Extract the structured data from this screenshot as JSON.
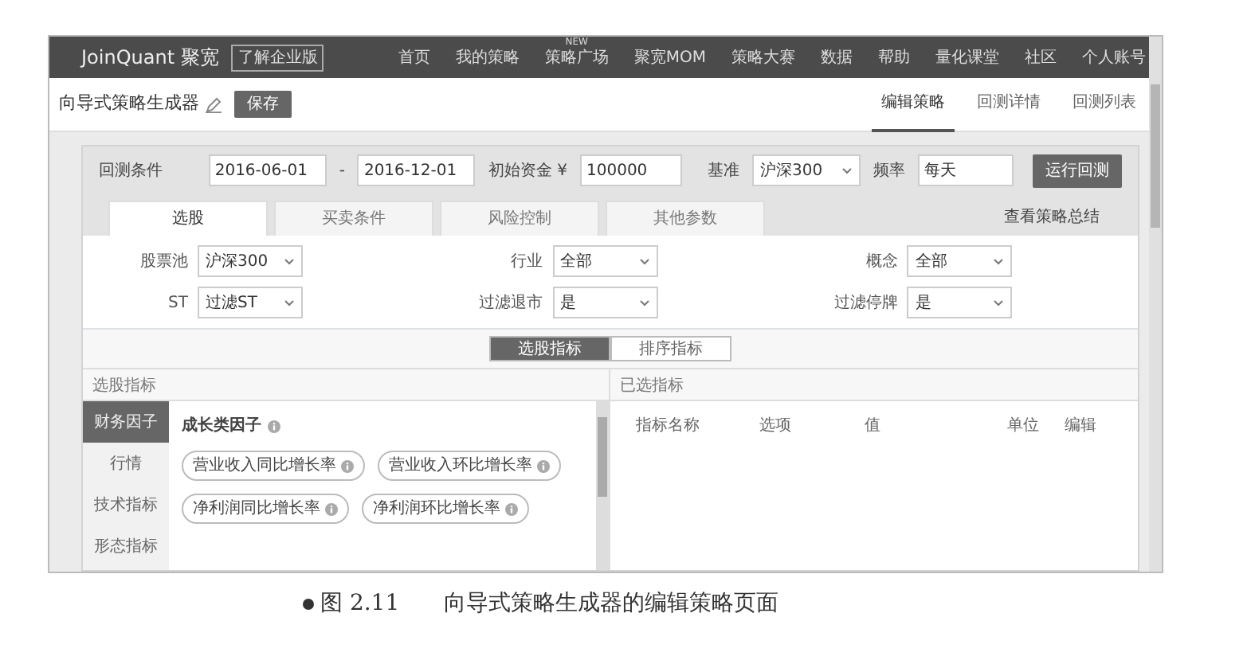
{
  "navbar": {
    "logo": "JoinQuant 聚宽",
    "edition_badge": "了解企业版",
    "items": [
      {
        "label": "首页"
      },
      {
        "label": "我的策略"
      },
      {
        "label": "策略广场",
        "badge": "NEW"
      },
      {
        "label": "聚宽MOM"
      },
      {
        "label": "策略大赛"
      },
      {
        "label": "数据"
      },
      {
        "label": "帮助"
      },
      {
        "label": "量化课堂"
      },
      {
        "label": "社区"
      },
      {
        "label": "个人账号"
      }
    ]
  },
  "header": {
    "title": "向导式策略生成器",
    "save": "保存",
    "tabs": [
      {
        "label": "编辑策略",
        "selected": true
      },
      {
        "label": "回测详情",
        "selected": false
      },
      {
        "label": "回测列表",
        "selected": false
      }
    ]
  },
  "conditions": {
    "title": "回测条件",
    "start": "2016-06-01",
    "dash": "-",
    "end": "2016-12-01",
    "capital_label": "初始资金 ¥",
    "capital": "100000",
    "benchmark_label": "基准",
    "benchmark": "沪深300",
    "frequency_label": "频率",
    "frequency": "每天",
    "run": "运行回测"
  },
  "tabs": [
    {
      "label": "选股",
      "selected": true
    },
    {
      "label": "买卖条件",
      "selected": false
    },
    {
      "label": "风险控制",
      "selected": false
    },
    {
      "label": "其他参数",
      "selected": false
    }
  ],
  "summary_link": "查看策略总结",
  "filters": [
    {
      "label": "股票池",
      "value": "沪深300"
    },
    {
      "label": "行业",
      "value": "全部"
    },
    {
      "label": "概念",
      "value": "全部"
    },
    {
      "label": "ST",
      "value": "过滤ST"
    },
    {
      "label": "过滤退市",
      "value": "是"
    },
    {
      "label": "过滤停牌",
      "value": "是"
    }
  ],
  "toggle": [
    {
      "label": "选股指标",
      "selected": true
    },
    {
      "label": "排序指标",
      "selected": false
    }
  ],
  "indicators": {
    "title": "选股指标",
    "categories": [
      {
        "label": "财务因子",
        "selected": true
      },
      {
        "label": "行情",
        "selected": false
      },
      {
        "label": "技术指标",
        "selected": false
      },
      {
        "label": "形态指标",
        "selected": false
      }
    ],
    "group": "成长类因子",
    "chips": [
      "营业收入同比增长率",
      "营业收入环比增长率",
      "净利润同比增长率",
      "净利润环比增长率"
    ]
  },
  "selected_indicators": {
    "title": "已选指标",
    "columns": [
      "指标名称",
      "选项",
      "值",
      "单位",
      "编辑"
    ]
  },
  "caption": {
    "number": "图 2.11",
    "text": "向导式策略生成器的编辑策略页面"
  }
}
